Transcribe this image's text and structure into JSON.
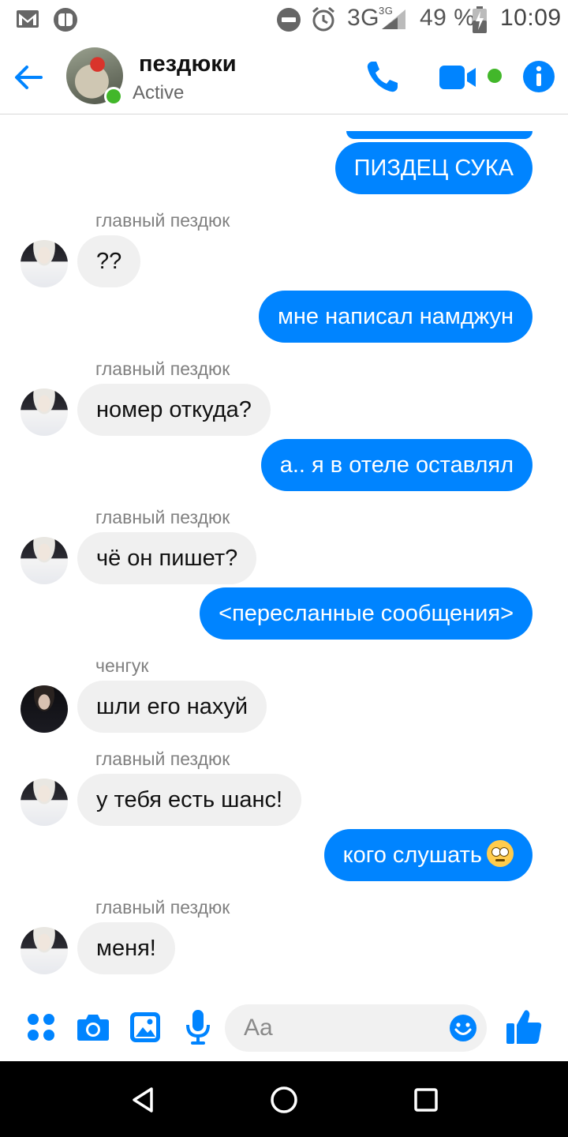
{
  "status_bar": {
    "network": "3G",
    "network_small": "3G",
    "battery": "49 %",
    "time": "10:09"
  },
  "header": {
    "title": "пездюки",
    "status": "Active",
    "accent": "#0084ff",
    "online_color": "#42b72a"
  },
  "messages": [
    {
      "dir": "out",
      "text": "ПИЗДЕЦ СУКА"
    },
    {
      "dir": "in",
      "sender": "главный пездюк",
      "text": "??"
    },
    {
      "dir": "out",
      "text": "мне написал намджун"
    },
    {
      "dir": "in",
      "sender": "главный пездюк",
      "text": "номер откуда?"
    },
    {
      "dir": "out",
      "text": "а.. я в отеле оставлял"
    },
    {
      "dir": "in",
      "sender": "главный пездюк",
      "text": "чё он пишет?"
    },
    {
      "dir": "out",
      "text": "<пересланные сообщения>"
    },
    {
      "dir": "in",
      "sender": "ченгук",
      "text": "шли его нахуй"
    },
    {
      "dir": "in",
      "sender": "главный пездюк",
      "text": "у тебя есть шанс!"
    },
    {
      "dir": "out",
      "text": "кого слушать",
      "emoji": "face-with-rolling-eyes"
    },
    {
      "dir": "in",
      "sender": "главный пездюк",
      "text": "меня!"
    }
  ],
  "composer": {
    "placeholder": "Aa",
    "icons": [
      "menu-dots-icon",
      "camera-icon",
      "gallery-icon",
      "microphone-icon",
      "emoji-icon",
      "thumbs-up-icon"
    ]
  }
}
